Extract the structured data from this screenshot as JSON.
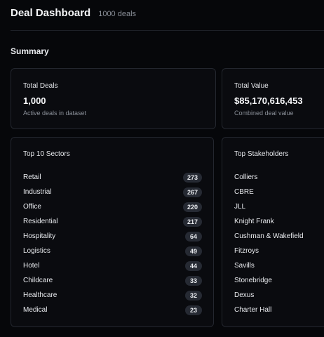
{
  "header": {
    "title": "Deal Dashboard",
    "count": "1000 deals"
  },
  "summary": {
    "title": "Summary",
    "total_deals": {
      "label": "Total Deals",
      "value": "1,000",
      "sub": "Active deals in dataset"
    },
    "total_value": {
      "label": "Total Value",
      "value": "$85,170,616,453",
      "sub": "Combined deal value"
    }
  },
  "sectors": {
    "title": "Top 10 Sectors",
    "items": [
      {
        "name": "Retail",
        "count": "273"
      },
      {
        "name": "Industrial",
        "count": "267"
      },
      {
        "name": "Office",
        "count": "220"
      },
      {
        "name": "Residential",
        "count": "217"
      },
      {
        "name": "Hospitality",
        "count": "64"
      },
      {
        "name": "Logistics",
        "count": "49"
      },
      {
        "name": "Hotel",
        "count": "44"
      },
      {
        "name": "Childcare",
        "count": "33"
      },
      {
        "name": "Healthcare",
        "count": "32"
      },
      {
        "name": "Medical",
        "count": "23"
      }
    ]
  },
  "stakeholders": {
    "title": "Top Stakeholders",
    "items": [
      {
        "name": "Colliers"
      },
      {
        "name": "CBRE"
      },
      {
        "name": "JLL"
      },
      {
        "name": "Knight Frank"
      },
      {
        "name": "Cushman & Wakefield"
      },
      {
        "name": "Fitzroys"
      },
      {
        "name": "Savills"
      },
      {
        "name": "Stonebridge"
      },
      {
        "name": "Dexus"
      },
      {
        "name": "Charter Hall"
      }
    ]
  }
}
